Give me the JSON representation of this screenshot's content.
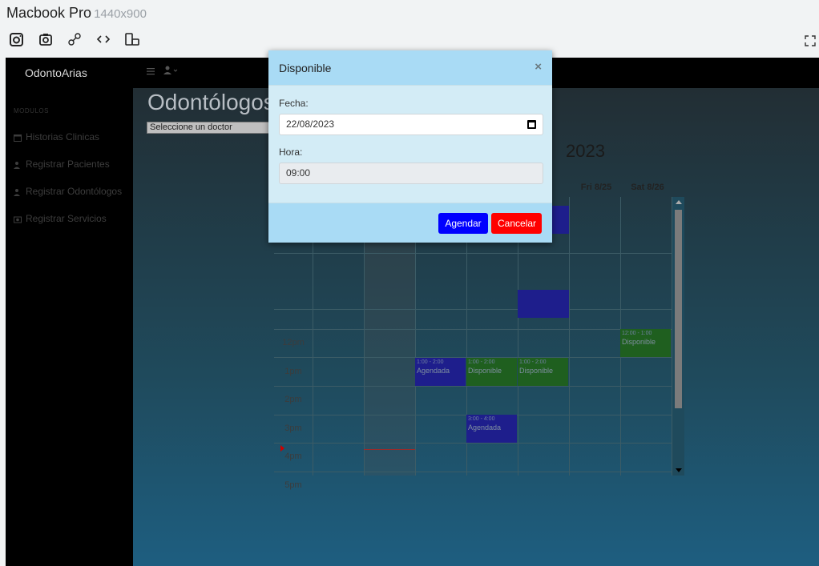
{
  "device": {
    "name": "Macbook Pro",
    "resolution": "1440x900",
    "tools": [
      {
        "icon": "instagram-icon"
      },
      {
        "icon": "camera-icon"
      },
      {
        "icon": "unlink-icon"
      },
      {
        "icon": "code-icon"
      },
      {
        "icon": "rotate-device-icon"
      }
    ],
    "expand_icon": "expand-icon"
  },
  "app": {
    "brand": "OdontoArias",
    "sidebar": {
      "heading": "MODULOS",
      "items": [
        {
          "label": "Historias Clinicas",
          "icon": "calendar-icon"
        },
        {
          "label": "Registrar Pacientes",
          "icon": "user-plus-icon"
        },
        {
          "label": "Registrar Odontólogos",
          "icon": "user-plus-icon"
        },
        {
          "label": "Registrar Servicios",
          "icon": "camera-icon"
        }
      ]
    },
    "page_title": "Odontólogos",
    "doctor_select": "Seleccione un doctor",
    "calendar": {
      "title": "2023",
      "headers": [
        "Fri 8/25",
        "Sat 8/26"
      ],
      "time_labels": [
        "12pm",
        "1pm",
        "2pm",
        "3pm",
        "4pm",
        "5pm"
      ],
      "events": [
        {
          "time": "1:00 - 2:00",
          "title": "Agendada",
          "status": "booked"
        },
        {
          "time": "1:00 - 2:00",
          "title": "Disponible",
          "status": "free"
        },
        {
          "time": "1:00 - 2:00",
          "title": "Disponible",
          "status": "free"
        },
        {
          "time": "12:00 - 1:00",
          "title": "Disponible",
          "status": "free"
        },
        {
          "time": "3:00 - 4:00",
          "title": "Agendada",
          "status": "booked"
        }
      ]
    },
    "modal": {
      "title": "Disponible",
      "close": "×",
      "fecha_label": "Fecha:",
      "fecha_value": "22/08/2023",
      "hora_label": "Hora:",
      "hora_value": "09:00",
      "primary_button": "Agendar",
      "cancel_button": "Cancelar"
    }
  },
  "colors": {
    "booked": "#1e1e8c",
    "free": "#1f5f1f",
    "primary": "#0000ff",
    "danger": "#ff0000",
    "modal_header": "#a9dbf5"
  }
}
